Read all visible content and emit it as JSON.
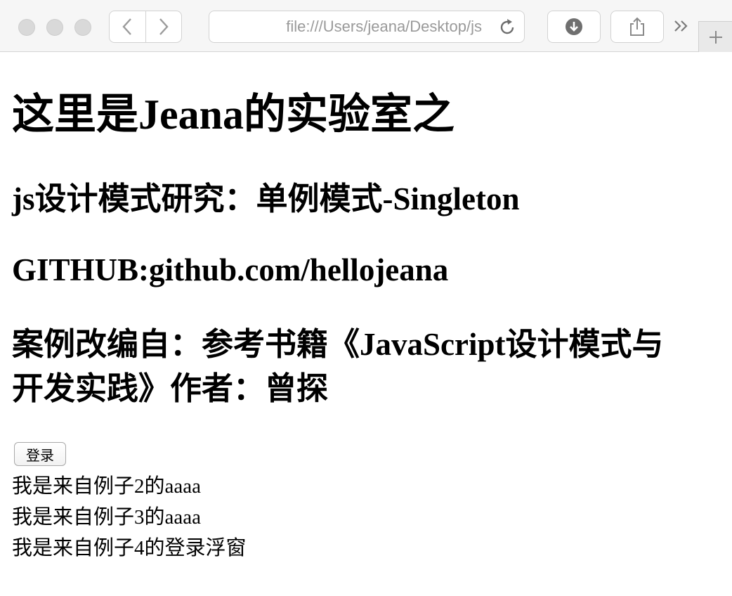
{
  "browser": {
    "url": "file:///Users/jeana/Desktop/js",
    "icons": {
      "back": "chevron-left-icon",
      "forward": "chevron-right-icon",
      "reload": "reload-icon",
      "download": "download-icon",
      "share": "share-icon",
      "more": "double-chevron-right-icon",
      "new_tab": "plus-icon"
    }
  },
  "page": {
    "title": "这里是Jeana的实验室之",
    "subtitle": "js设计模式研究：单例模式-Singleton",
    "github": "GITHUB:github.com/hellojeana",
    "source_line1": "案例改编自：参考书籍《JavaScript设计模式与",
    "source_line2": "开发实践》作者：曾探",
    "login_button": "登录",
    "lines": [
      "我是来自例子2的aaaa",
      "我是来自例子3的aaaa",
      "我是来自例子4的登录浮窗"
    ]
  }
}
